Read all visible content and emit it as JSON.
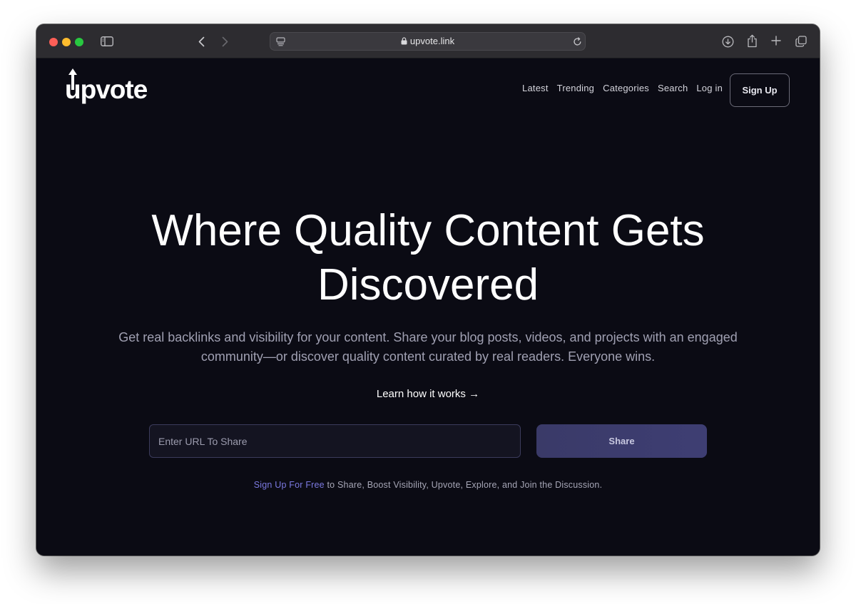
{
  "browser": {
    "url": "upvote.link"
  },
  "site": {
    "logo_text": "pvote",
    "logo_first": "u"
  },
  "nav": {
    "items": [
      {
        "label": "Latest"
      },
      {
        "label": "Trending"
      },
      {
        "label": "Categories"
      },
      {
        "label": "Search"
      },
      {
        "label": "Log in"
      }
    ],
    "signup_label": "Sign Up"
  },
  "hero": {
    "title_line1": "Where Quality Content Gets",
    "title_line2": "Discovered",
    "subtitle_line1": "Get real backlinks and visibility for your content. Share your blog posts, videos, and projects with an engaged",
    "subtitle_line2": "community—or discover quality content curated by real readers. Everyone wins.",
    "learn_link": "Learn how it works →"
  },
  "share_form": {
    "placeholder": "Enter URL To Share",
    "button_label": "Share"
  },
  "footer_note": {
    "link_text": "Sign Up For Free",
    "rest_text": " to Share, Boost Visibility, Upvote, Explore, and Join the Discussion."
  },
  "colors": {
    "page_bg": "#0b0b14",
    "accent_link": "#7b79e0",
    "share_button": "#3c3c6e"
  },
  "icons": {
    "toolbar": [
      "sidebar-icon",
      "back-icon",
      "forward-icon",
      "tab-overview-icon",
      "lock-icon",
      "reload-icon",
      "download-icon",
      "share-icon",
      "new-tab-icon",
      "tabs-icon"
    ]
  }
}
